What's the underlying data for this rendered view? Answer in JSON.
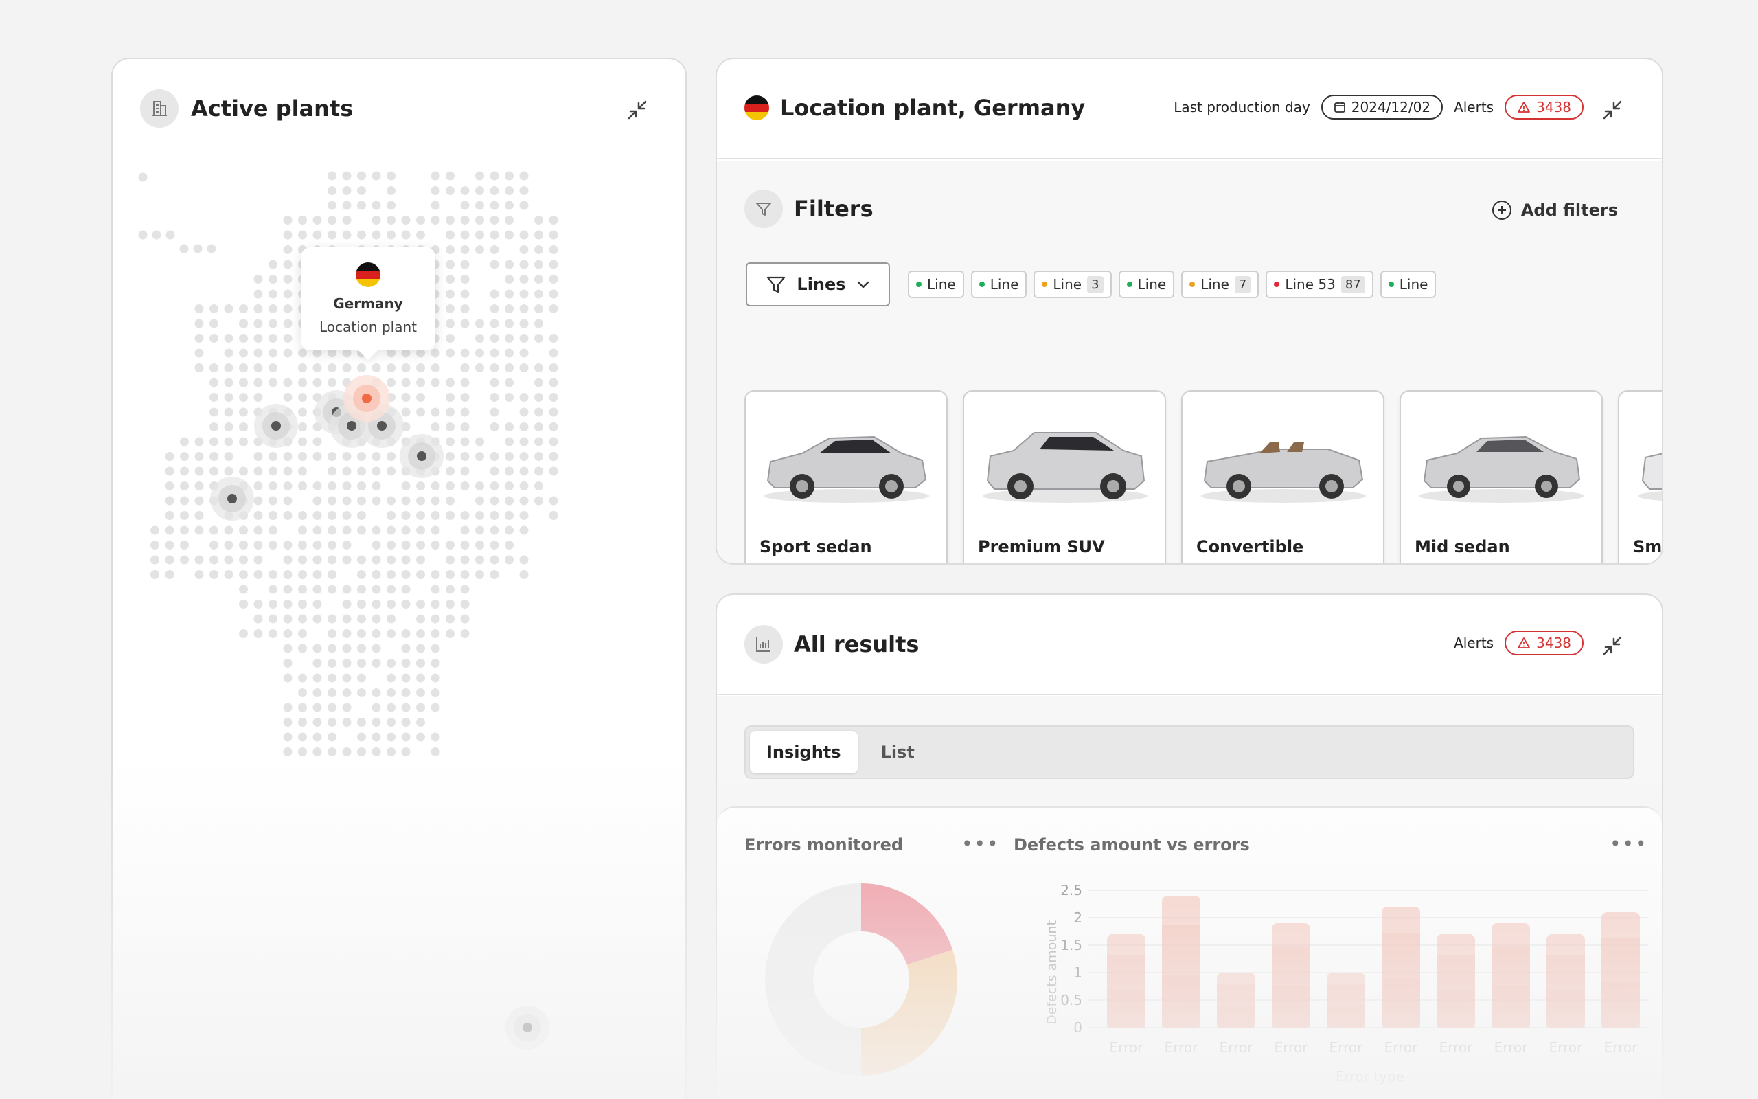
{
  "map_card": {
    "title": "Active plants",
    "tooltip": {
      "country": "Germany",
      "subtitle": "Location plant"
    }
  },
  "location_card": {
    "title": "Location plant, Germany",
    "last_production_label": "Last production day",
    "date": "2024/12/02",
    "alerts_label": "Alerts",
    "alerts_count": "3438",
    "filters_title": "Filters",
    "add_filters_label": "Add filters",
    "lines_dropdown_label": "Lines",
    "chips": [
      {
        "label": "Line",
        "color": "#1eae5c",
        "count": ""
      },
      {
        "label": "Line",
        "color": "#1eae5c",
        "count": ""
      },
      {
        "label": "Line",
        "color": "#f0a020",
        "count": "3"
      },
      {
        "label": "Line",
        "color": "#1eae5c",
        "count": ""
      },
      {
        "label": "Line",
        "color": "#f0a020",
        "count": "7"
      },
      {
        "label": "Line 53",
        "color": "#e0283a",
        "count": "87"
      },
      {
        "label": "Line",
        "color": "#1eae5c",
        "count": ""
      }
    ],
    "cars": [
      {
        "name": "Sport sedan"
      },
      {
        "name": "Premium SUV"
      },
      {
        "name": "Convertible"
      },
      {
        "name": "Mid sedan"
      },
      {
        "name": "Sma"
      }
    ]
  },
  "results_card": {
    "title": "All results",
    "alerts_label": "Alerts",
    "alerts_count": "3438",
    "tabs": [
      {
        "label": "Insights",
        "active": true
      },
      {
        "label": "List",
        "active": false
      }
    ],
    "donut_title": "Errors monitored",
    "more_label": "•••",
    "bar_title": "Defects amount vs errors"
  },
  "chart_data": [
    {
      "type": "pie",
      "title": "Errors monitored",
      "values": [
        20,
        30,
        50
      ],
      "colors": [
        "#ee8a94",
        "#f6c896",
        "#ececec"
      ]
    },
    {
      "type": "bar",
      "title": "Defects amount vs errors",
      "xlabel": "Error type",
      "ylabel": "Defects amount",
      "ylim": [
        0,
        2.5
      ],
      "yticks": [
        "2.5",
        "2",
        "1.5",
        "1",
        "0.5",
        "0"
      ],
      "categories": [
        "Error",
        "Error",
        "Error",
        "Error",
        "Error",
        "Error",
        "Error",
        "Error",
        "Error",
        "Error"
      ],
      "values": [
        1.7,
        2.4,
        1.0,
        1.9,
        1.0,
        2.2,
        1.7,
        1.9,
        1.7,
        2.1
      ],
      "color": "#f2a08e"
    }
  ]
}
